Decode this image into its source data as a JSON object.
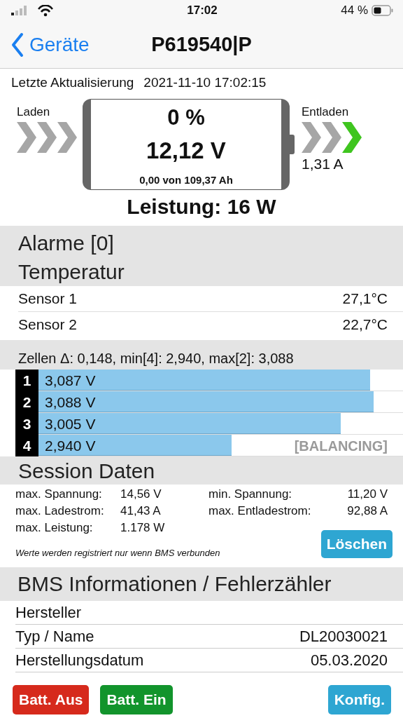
{
  "status_bar": {
    "time": "17:02",
    "battery": "44 %"
  },
  "nav": {
    "back": "Geräte",
    "title": "P619540|P"
  },
  "update": {
    "label": "Letzte Aktualisierung",
    "value": "2021-11-10 17:02:15"
  },
  "charge": {
    "label": "Laden",
    "chevrons": [
      {
        "active": false
      },
      {
        "active": false
      },
      {
        "active": false
      }
    ]
  },
  "discharge": {
    "label": "Entladen",
    "reading": "1,31 A",
    "chevrons": [
      {
        "active": false
      },
      {
        "active": false
      },
      {
        "active": true
      }
    ]
  },
  "battery": {
    "soc": "0 %",
    "voltage": "12,12 V",
    "capacity": "0,00 von 109,37 Ah"
  },
  "power": "Leistung: 16 W",
  "alarms_title": "Alarme [0]",
  "temperature_title": "Temperatur",
  "sensors": [
    {
      "name": "Sensor 1",
      "value": "27,1°C"
    },
    {
      "name": "Sensor 2",
      "value": "22,7°C"
    }
  ],
  "cells_summary": "Zellen Δ: 0,148, min[4]: 2,940, max[2]: 3,088",
  "cells": [
    {
      "index": "1",
      "voltage": "3,087 V",
      "level": 0.91
    },
    {
      "index": "2",
      "voltage": "3,088 V",
      "level": 0.92
    },
    {
      "index": "3",
      "voltage": "3,005 V",
      "level": 0.83
    },
    {
      "index": "4",
      "voltage": "2,940 V",
      "level": 0.53,
      "status": "[BALANCING]"
    }
  ],
  "session": {
    "title": "Session Daten",
    "stats": [
      {
        "label": "max. Spannung:",
        "value": "14,56 V"
      },
      {
        "label": "min. Spannung:",
        "value": "11,20 V"
      },
      {
        "label": "max. Ladestrom:",
        "value": "41,43 A"
      },
      {
        "label": "max. Entladestrom:",
        "value": "92,88 A"
      },
      {
        "label": "max. Leistung:",
        "value": "1.178 W"
      }
    ],
    "note": "Werte werden registriert nur wenn BMS verbunden",
    "button": "Löschen"
  },
  "bms": {
    "title": "BMS Informationen / Fehlerzähler",
    "rows": [
      {
        "label": "Hersteller"
      },
      {
        "label": "Typ / Name",
        "value": "DL20030021"
      },
      {
        "label": "Herstellungsdatum",
        "value": "05.03.2020"
      }
    ]
  },
  "buttons": [
    {
      "label": "Batt. Aus",
      "kind": "danger"
    },
    {
      "label": "Batt. Ein",
      "kind": "success"
    },
    {
      "label": "Konfig.",
      "kind": "info"
    }
  ]
}
